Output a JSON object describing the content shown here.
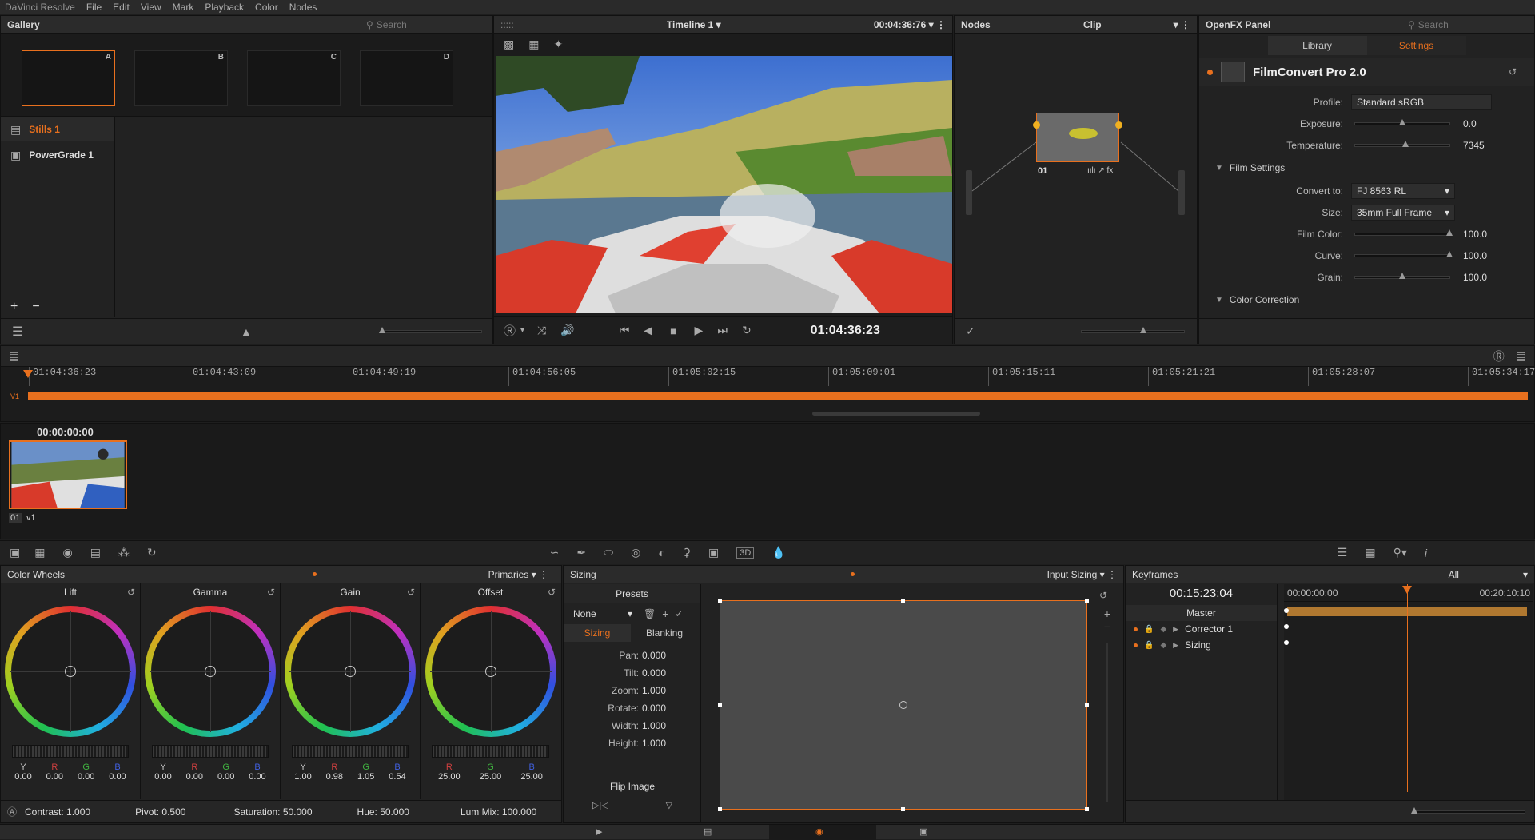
{
  "menubar": {
    "app": "DaVinci Resolve",
    "items": [
      "File",
      "Edit",
      "View",
      "Mark",
      "Playback",
      "Color",
      "Nodes"
    ]
  },
  "gallery": {
    "title": "Gallery",
    "search_placeholder": "Search",
    "slots": [
      "A",
      "B",
      "C",
      "D"
    ],
    "albums": [
      "Stills 1",
      "PowerGrade 1"
    ]
  },
  "viewer": {
    "timeline_name": "Timeline 1",
    "header_timecode": "00:04:36:76",
    "timecode": "01:04:36:23"
  },
  "nodes": {
    "title": "Nodes",
    "mode": "Clip",
    "node_label": "01"
  },
  "openfx": {
    "title": "OpenFX Panel",
    "search_placeholder": "Search",
    "tabs": [
      "Library",
      "Settings"
    ],
    "plugin": "FilmConvert Pro 2.0",
    "profile_label": "Profile:",
    "profile_value": "Standard sRGB",
    "exposure_label": "Exposure:",
    "exposure_value": "0.0",
    "exposure_level": 0.5,
    "temperature_label": "Temperature:",
    "temperature_value": "7345",
    "temperature_level": 0.53,
    "film_settings": "Film Settings",
    "convert_label": "Convert to:",
    "convert_value": "FJ 8563 RL",
    "size_label": "Size:",
    "size_value": "35mm Full Frame",
    "film_color_label": "Film Color:",
    "film_color_value": "100.0",
    "curve_label": "Curve:",
    "curve_value": "100.0",
    "grain_label": "Grain:",
    "grain_value": "100.0",
    "grain_level": 0.5,
    "color_correction": "Color Correction"
  },
  "timeline": {
    "track": "V1",
    "ticks": [
      "01:04:36:23",
      "01:04:43:09",
      "01:04:49:19",
      "01:04:56:05",
      "01:05:02:15",
      "01:05:09:01",
      "01:05:15:11",
      "01:05:21:21",
      "01:05:28:07",
      "01:05:34:17"
    ]
  },
  "clips": {
    "timecode": "00:00:00:00",
    "clip_number": "01",
    "clip_track": "V1"
  },
  "color_wheels": {
    "title": "Color Wheels",
    "mode": "Primaries",
    "wheels": [
      {
        "name": "Lift",
        "values": [
          "0.00",
          "0.00",
          "0.00",
          "0.00"
        ]
      },
      {
        "name": "Gamma",
        "values": [
          "0.00",
          "0.00",
          "0.00",
          "0.00"
        ]
      },
      {
        "name": "Gain",
        "values": [
          "1.00",
          "0.98",
          "1.05",
          "0.54"
        ]
      },
      {
        "name": "Offset",
        "values": [
          "25.00",
          "25.00",
          "25.00"
        ]
      }
    ],
    "channels": [
      "Y",
      "R",
      "G",
      "B"
    ],
    "footer": {
      "contrast": "Contrast: 1.000",
      "pivot": "Pivot: 0.500",
      "saturation": "Saturation: 50.000",
      "hue": "Hue: 50.000",
      "lum_mix": "Lum Mix: 100.000"
    }
  },
  "sizing": {
    "title": "Sizing",
    "mode": "Input Sizing",
    "presets": "Presets",
    "preset_value": "None",
    "tabs": [
      "Sizing",
      "Blanking"
    ],
    "params": [
      {
        "label": "Pan:",
        "value": "0.000"
      },
      {
        "label": "Tilt:",
        "value": "0.000"
      },
      {
        "label": "Zoom:",
        "value": "1.000"
      },
      {
        "label": "Rotate:",
        "value": "0.000"
      },
      {
        "label": "Width:",
        "value": "1.000"
      },
      {
        "label": "Height:",
        "value": "1.000"
      }
    ],
    "flip": "Flip Image"
  },
  "keyframes": {
    "title": "Keyframes",
    "filter": "All",
    "timecode": "00:15:23:04",
    "ruler_start": "00:00:00:00",
    "ruler_end": "00:20:10:10",
    "rows": [
      "Master",
      "Corrector 1",
      "Sizing"
    ]
  },
  "colors": {
    "accent": "#e8701e",
    "bg": "#1e1e1e",
    "panel": "#222222"
  }
}
